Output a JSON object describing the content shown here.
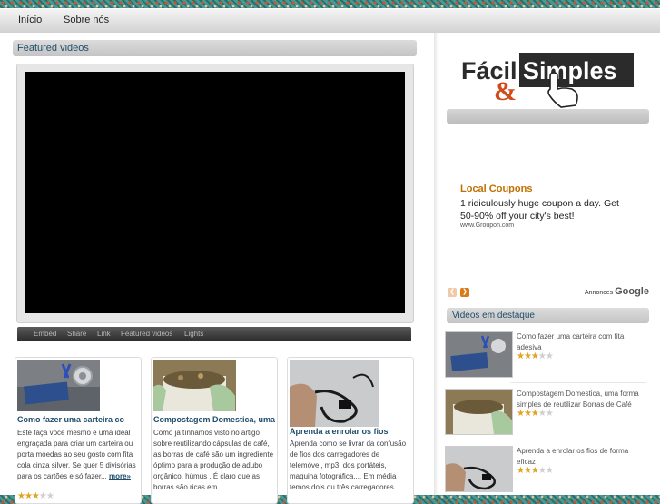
{
  "nav": {
    "items": [
      "Início",
      "Sobre nós"
    ]
  },
  "featured": {
    "heading": "Featured videos"
  },
  "player_bar": {
    "items": [
      "Embed",
      "Share",
      "Link",
      "Featured videos",
      "Lights"
    ]
  },
  "cards": [
    {
      "title": "Como fazer uma carteira co",
      "desc": "Este faça você mesmo é uma ideal engraçada para criar um carteira ou porta moedas ao seu gosto com  fita cola  cinza silver. Se quer 5 divisórias para os cartões e só fazer... ",
      "more": "more»",
      "rating": 3
    },
    {
      "title": "Compostagem Domestica, uma",
      "desc": "Como já tínhamos  visto no artigo sobre reutilizando cápsulas de café,  as borras de café são um ingrediente óptimo para a produção de adubo orgânico,  húmus . É claro que as borras são ricas em",
      "rating": 0
    },
    {
      "title": "Aprenda a enrolar os fios",
      "desc": "Aprenda como se livrar da confusão de fios dos carregadores de telemóvel, mp3,  dos portáteis, maquina fotográfica.... Em média  temos  dois ou três carregadores",
      "rating": 0
    }
  ],
  "logo": {
    "word1": "Fácil",
    "amp": "&",
    "word2": "Simples"
  },
  "ad": {
    "title": "Local Coupons",
    "text": "1 ridiculously huge coupon a day. Get 50-90% off your city's best!",
    "url": "www.Groupon.com",
    "annonces": "Annonces",
    "google": "Google"
  },
  "sidebar_videos": {
    "heading": "Videos em destaque",
    "items": [
      {
        "title": "Como fazer uma carteira com fita adesiva",
        "rating": 3
      },
      {
        "title": "Compostagem Domestica, uma forma simples de reutilizar Borras de Café",
        "rating": 3
      },
      {
        "title": "Aprenda a enrolar os fios de forma eficaz",
        "rating": 3
      }
    ]
  },
  "colors": {
    "link_blue": "#1f4d6b",
    "ad_title": "#c07000",
    "star": "#e1a421"
  }
}
